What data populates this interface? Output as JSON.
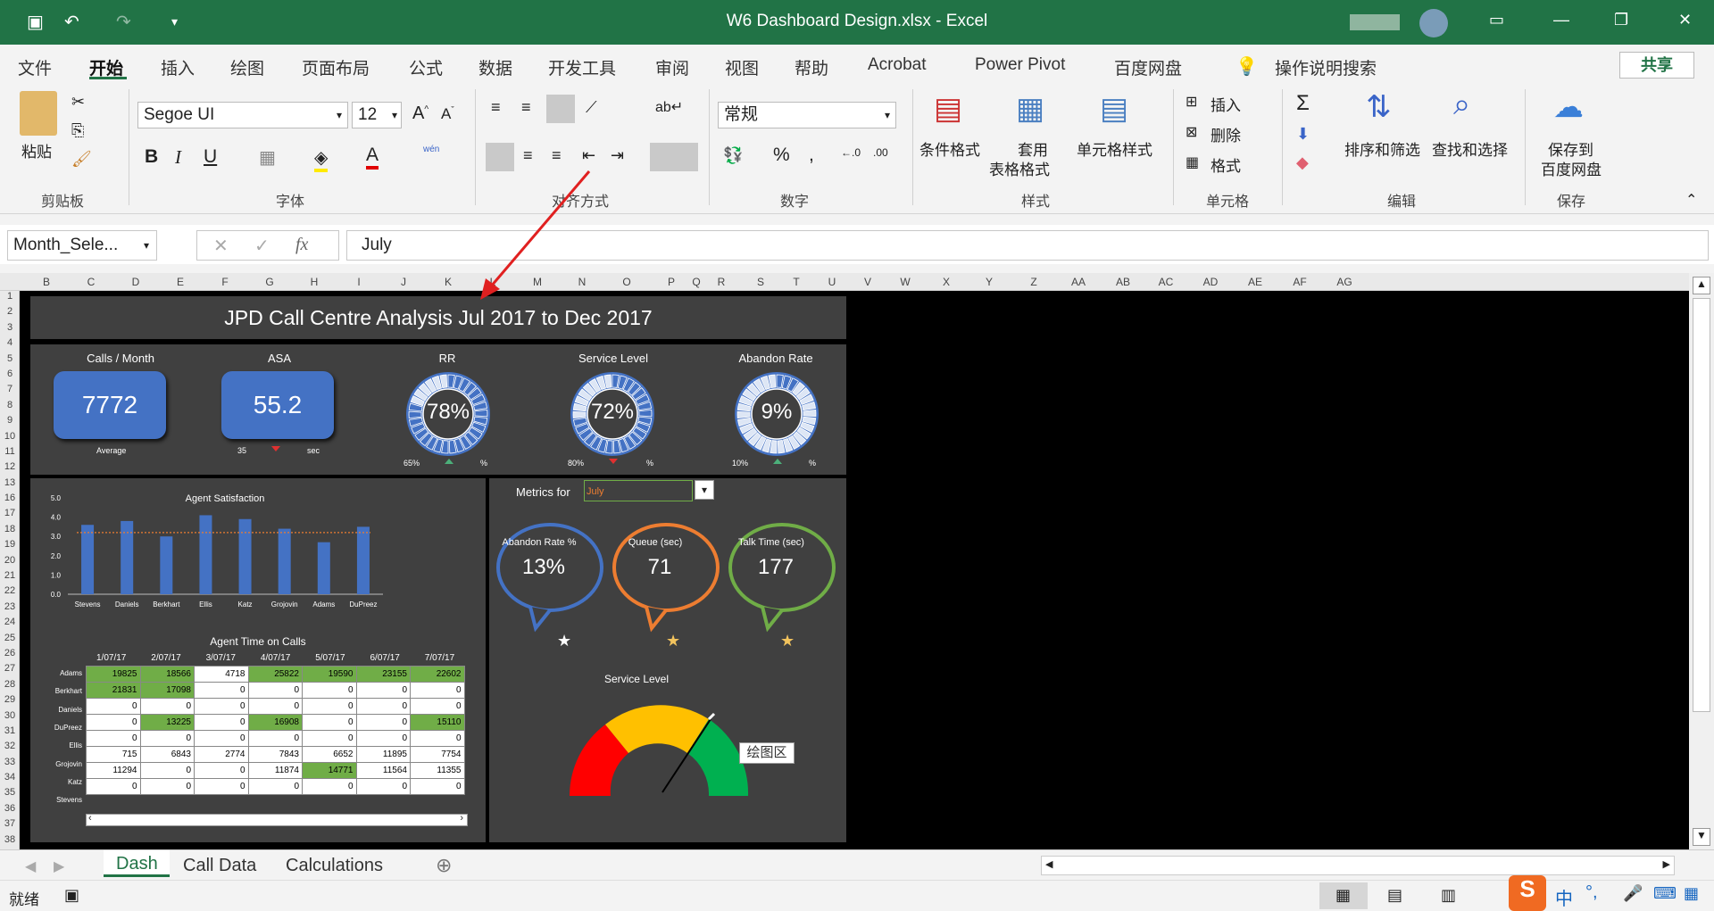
{
  "window": {
    "title": "W6 Dashboard Design.xlsx  -  Excel"
  },
  "tabs": [
    "文件",
    "开始",
    "插入",
    "绘图",
    "页面布局",
    "公式",
    "数据",
    "开发工具",
    "审阅",
    "视图",
    "帮助",
    "Acrobat",
    "Power Pivot",
    "百度网盘",
    "操作说明搜索"
  ],
  "share": "共享",
  "ribbon": {
    "paste": "粘贴",
    "font_name": "Segoe UI",
    "font_size": "12",
    "number_format": "常规",
    "cond_format": "条件格式",
    "table_format_1": "套用",
    "table_format_2": "表格格式",
    "cell_style": "单元格样式",
    "insert": "插入",
    "delete": "删除",
    "format": "格式",
    "sort_filter": "排序和筛选",
    "find_select": "查找和选择",
    "save_baidu_1": "保存到",
    "save_baidu_2": "百度网盘",
    "groups": [
      "剪贴板",
      "字体",
      "对齐方式",
      "数字",
      "样式",
      "单元格",
      "编辑",
      "保存"
    ],
    "wen": "wén"
  },
  "formula": {
    "name_box": "Month_Sele...",
    "value": "July"
  },
  "columns": [
    "B",
    "C",
    "D",
    "E",
    "F",
    "G",
    "H",
    "I",
    "J",
    "K",
    "L",
    "M",
    "N",
    "O",
    "P",
    "Q",
    "R",
    "S",
    "T",
    "U",
    "V",
    "W",
    "X",
    "Y",
    "Z",
    "AA",
    "AB",
    "AC",
    "AD",
    "AE",
    "AF",
    "AG"
  ],
  "rows": [
    "1",
    "2",
    "3",
    "4",
    "5",
    "6",
    "7",
    "8",
    "9",
    "10",
    "11",
    "12",
    "13",
    "16",
    "17",
    "18",
    "19",
    "20",
    "21",
    "22",
    "23",
    "24",
    "25",
    "26",
    "27",
    "28",
    "29",
    "30",
    "31",
    "32",
    "33",
    "34",
    "35",
    "36",
    "37",
    "38"
  ],
  "dash": {
    "title": "JPD Call Centre Analysis Jul 2017 to Dec 2017",
    "kpis": [
      {
        "label": "Calls / Month",
        "value": "7772",
        "sub": "Average"
      },
      {
        "label": "ASA",
        "value": "55.2",
        "sub_left": "35",
        "sub_right": "sec"
      },
      {
        "label": "RR",
        "value": "78%",
        "sub_left": "65%",
        "sub_right": "%"
      },
      {
        "label": "Service Level",
        "value": "72%",
        "sub_left": "80%",
        "sub_right": "%"
      },
      {
        "label": "Abandon Rate",
        "value": "9%",
        "sub_left": "10%",
        "sub_right": "%"
      }
    ],
    "metrics_label": "Metrics for",
    "month": "July",
    "bubbles": [
      {
        "label": "Abandon Rate %",
        "value": "13%",
        "color": "#4472c4"
      },
      {
        "label": "Queue  (sec)",
        "value": "71",
        "color": "#ed7d31"
      },
      {
        "label": "Talk Time (sec)",
        "value": "177",
        "color": "#70ad47"
      }
    ],
    "gauge_title": "Service Level",
    "gauge_tooltip": "绘图区",
    "table_title": "Agent Time on Calls",
    "table_dates": [
      "1/07/17",
      "2/07/17",
      "3/07/17",
      "4/07/17",
      "5/07/17",
      "6/07/17",
      "7/07/17"
    ],
    "table_rows": [
      {
        "name": "Adams",
        "vals": [
          "19825",
          "18566",
          "4718",
          "25822",
          "19590",
          "23155",
          "22602"
        ]
      },
      {
        "name": "Berkhart",
        "vals": [
          "21831",
          "17098",
          "0",
          "0",
          "0",
          "0",
          "0"
        ]
      },
      {
        "name": "Daniels",
        "vals": [
          "0",
          "0",
          "0",
          "0",
          "0",
          "0",
          "0"
        ]
      },
      {
        "name": "DuPreez",
        "vals": [
          "0",
          "13225",
          "0",
          "16908",
          "0",
          "0",
          "15110"
        ]
      },
      {
        "name": "Ellis",
        "vals": [
          "0",
          "0",
          "0",
          "0",
          "0",
          "0",
          "0"
        ]
      },
      {
        "name": "Grojovin",
        "vals": [
          "715",
          "6843",
          "2774",
          "7843",
          "6652",
          "11895",
          "7754"
        ]
      },
      {
        "name": "Katz",
        "vals": [
          "11294",
          "0",
          "0",
          "11874",
          "14771",
          "11564",
          "11355"
        ]
      },
      {
        "name": "Stevens",
        "vals": [
          "0",
          "0",
          "0",
          "0",
          "0",
          "0",
          "0"
        ]
      }
    ]
  },
  "chart_data": {
    "type": "bar",
    "title": "Agent Satisfaction",
    "categories": [
      "Stevens",
      "Daniels",
      "Berkhart",
      "Ellis",
      "Katz",
      "Grojovin",
      "Adams",
      "DuPreez"
    ],
    "values": [
      3.6,
      3.8,
      3.0,
      4.1,
      3.9,
      3.4,
      2.7,
      3.5
    ],
    "ylim": [
      0,
      5
    ],
    "yticks": [
      "0.0",
      "1.0",
      "2.0",
      "3.0",
      "4.0",
      "5.0"
    ],
    "reference_line": 3.2
  },
  "sheets": [
    "Dash",
    "Call Data",
    "Calculations"
  ],
  "status": {
    "ready": "就绪"
  }
}
